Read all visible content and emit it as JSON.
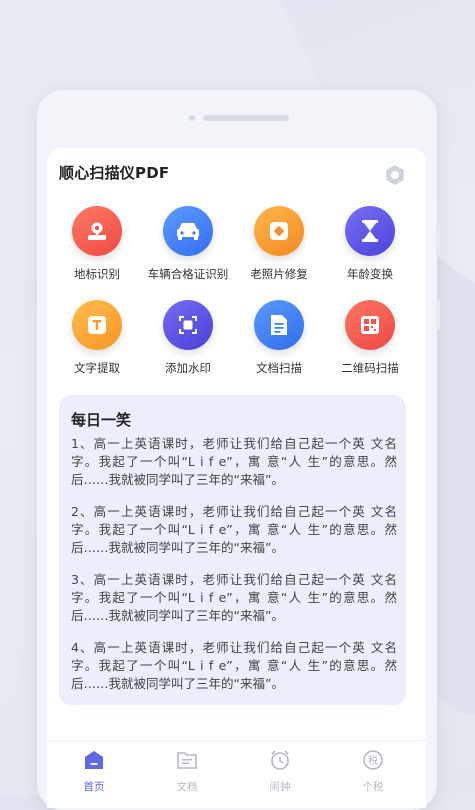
{
  "app": {
    "title": "顺心扫描仪PDF"
  },
  "tools": [
    {
      "label": "地标识别",
      "icon": "landmark-icon",
      "color": "#f0564c"
    },
    {
      "label": "车辆合格证识别",
      "icon": "car-icon",
      "color": "#3f7ef5"
    },
    {
      "label": "老照片修复",
      "icon": "flower-icon",
      "color": "#f59a2c"
    },
    {
      "label": "年龄变换",
      "icon": "hourglass-icon",
      "color": "#5b54e6"
    },
    {
      "label": "文字提取",
      "icon": "text-t-icon",
      "color": "#f7a22b"
    },
    {
      "label": "添加水印",
      "icon": "watermark-icon",
      "color": "#5a4fe2"
    },
    {
      "label": "文档扫描",
      "icon": "document-icon",
      "color": "#3e7ff6"
    },
    {
      "label": "二维码扫描",
      "icon": "qrcode-icon",
      "color": "#f1564b"
    }
  ],
  "joke": {
    "title": "每日一笑",
    "items": [
      "1、高一上英语课时，老师让我们给自己起一个英 文名 字。我起了一个叫“L i f e”，寓 意“人 生”的意思。然后……我就被同学叫了三年的“来福”。",
      "2、高一上英语课时，老师让我们给自己起一个英 文名 字。我起了一个叫“L i f e”，寓 意“人 生”的意思。然后……我就被同学叫了三年的“来福”。",
      "3、高一上英语课时，老师让我们给自己起一个英 文名 字。我起了一个叫“L i f e”，寓 意“人 生”的意思。然后……我就被同学叫了三年的“来福”。",
      "4、高一上英语课时，老师让我们给自己起一个英 文名 字。我起了一个叫“L i f e”，寓 意“人 生”的意思。然后……我就被同学叫了三年的“来福”。"
    ]
  },
  "tabs": [
    {
      "label": "首页",
      "icon": "home-icon",
      "active": true
    },
    {
      "label": "文档",
      "icon": "folder-icon",
      "active": false
    },
    {
      "label": "闹钟",
      "icon": "alarm-clock-icon",
      "active": false
    },
    {
      "label": "个税",
      "icon": "tax-icon",
      "active": false
    }
  ],
  "colors": {
    "accent": "#5a62e0",
    "card_bg": "#eceefb"
  }
}
